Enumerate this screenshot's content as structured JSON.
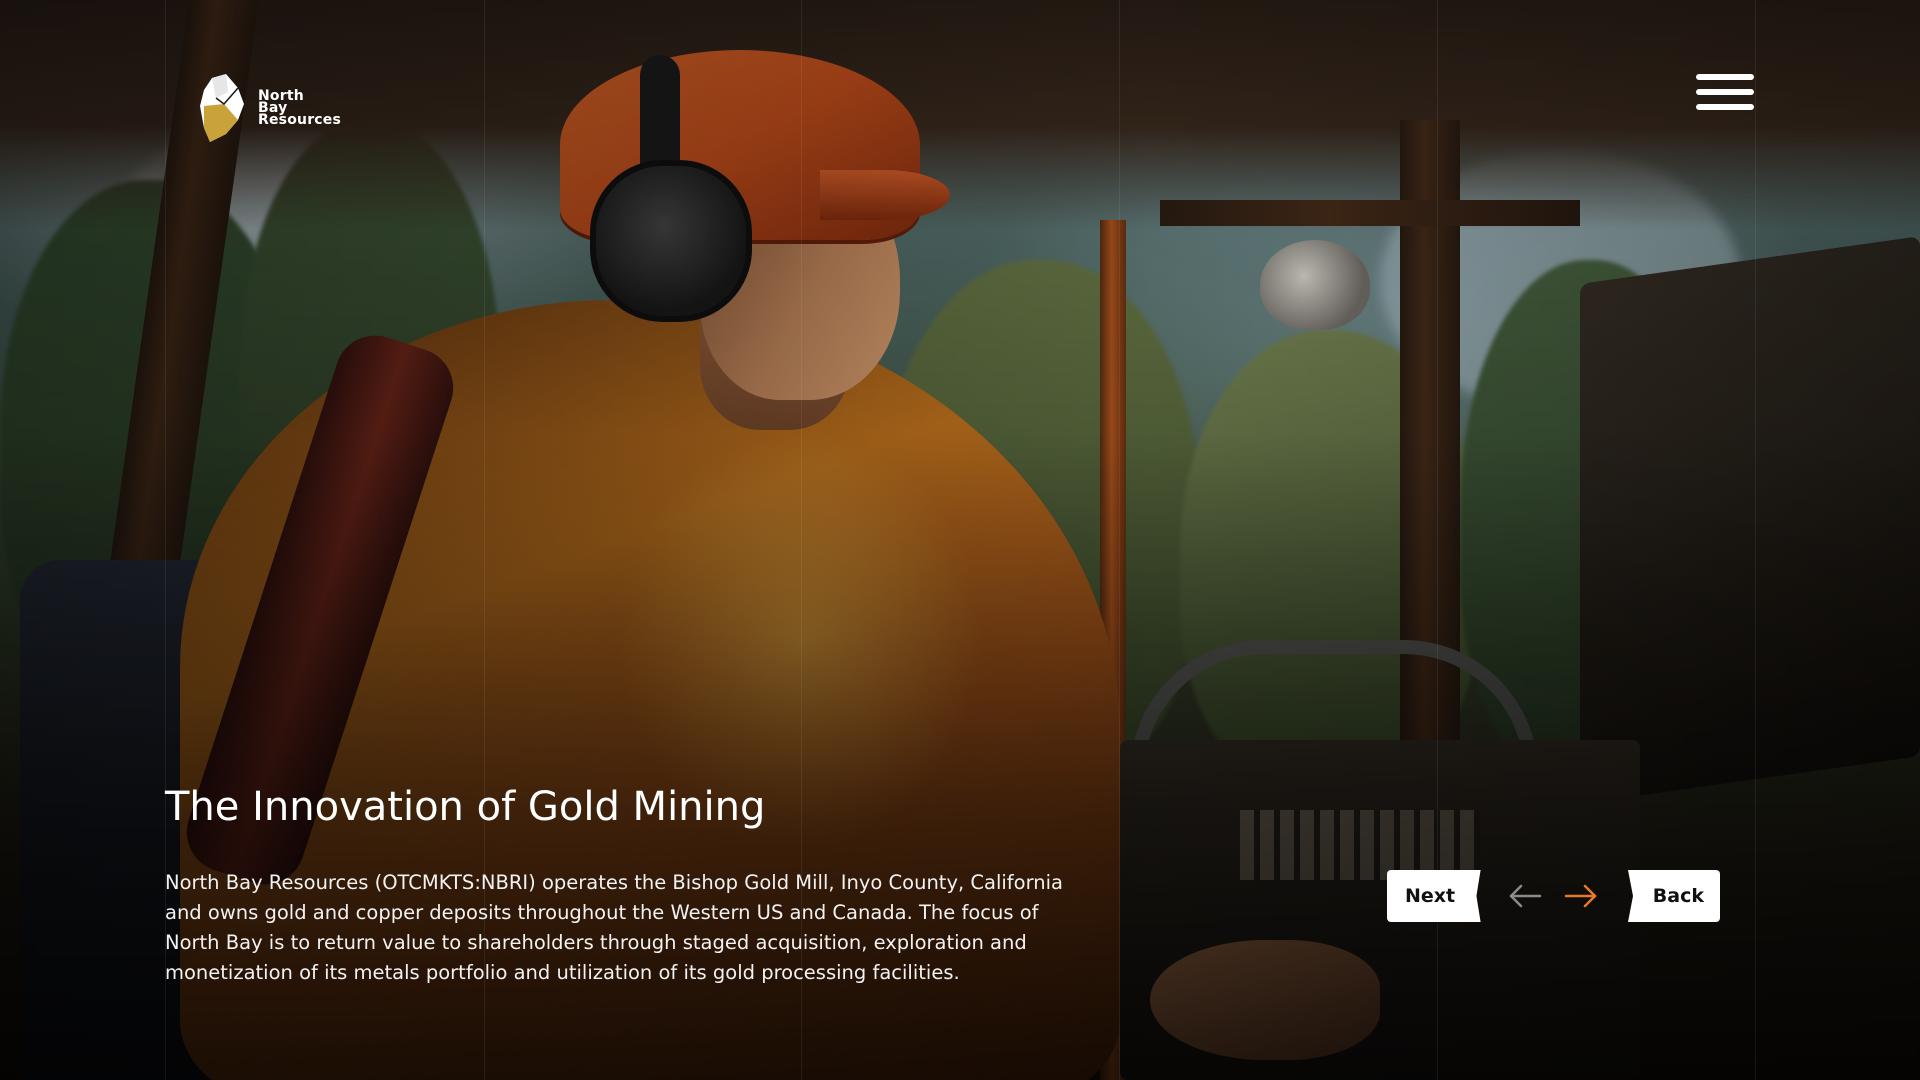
{
  "header": {
    "logo_lines": [
      "North",
      "Bay",
      "Resources"
    ],
    "menu_icon": "hamburger-menu-icon"
  },
  "hero": {
    "title": "The Innovation of Gold Mining",
    "description": "North Bay Resources (OTCMKTS:NBRI) operates the Bishop Gold Mill, Inyo County, California and owns gold and copper deposits throughout the Western US and Canada.  The focus of North Bay is to return value to shareholders through staged acquisition, exploration and monetization of its metals portfolio and utilization of its gold processing facilities."
  },
  "slider": {
    "next_label": "Next",
    "back_label": "Back",
    "prev_arrow_icon": "arrow-left-icon",
    "next_arrow_icon": "arrow-right-icon"
  },
  "colors": {
    "accent": "#e8782a",
    "arrow_inactive": "#8a8a8a",
    "button_bg": "#ffffff",
    "button_text": "#111111",
    "logo_gold": "#c9a23a"
  }
}
